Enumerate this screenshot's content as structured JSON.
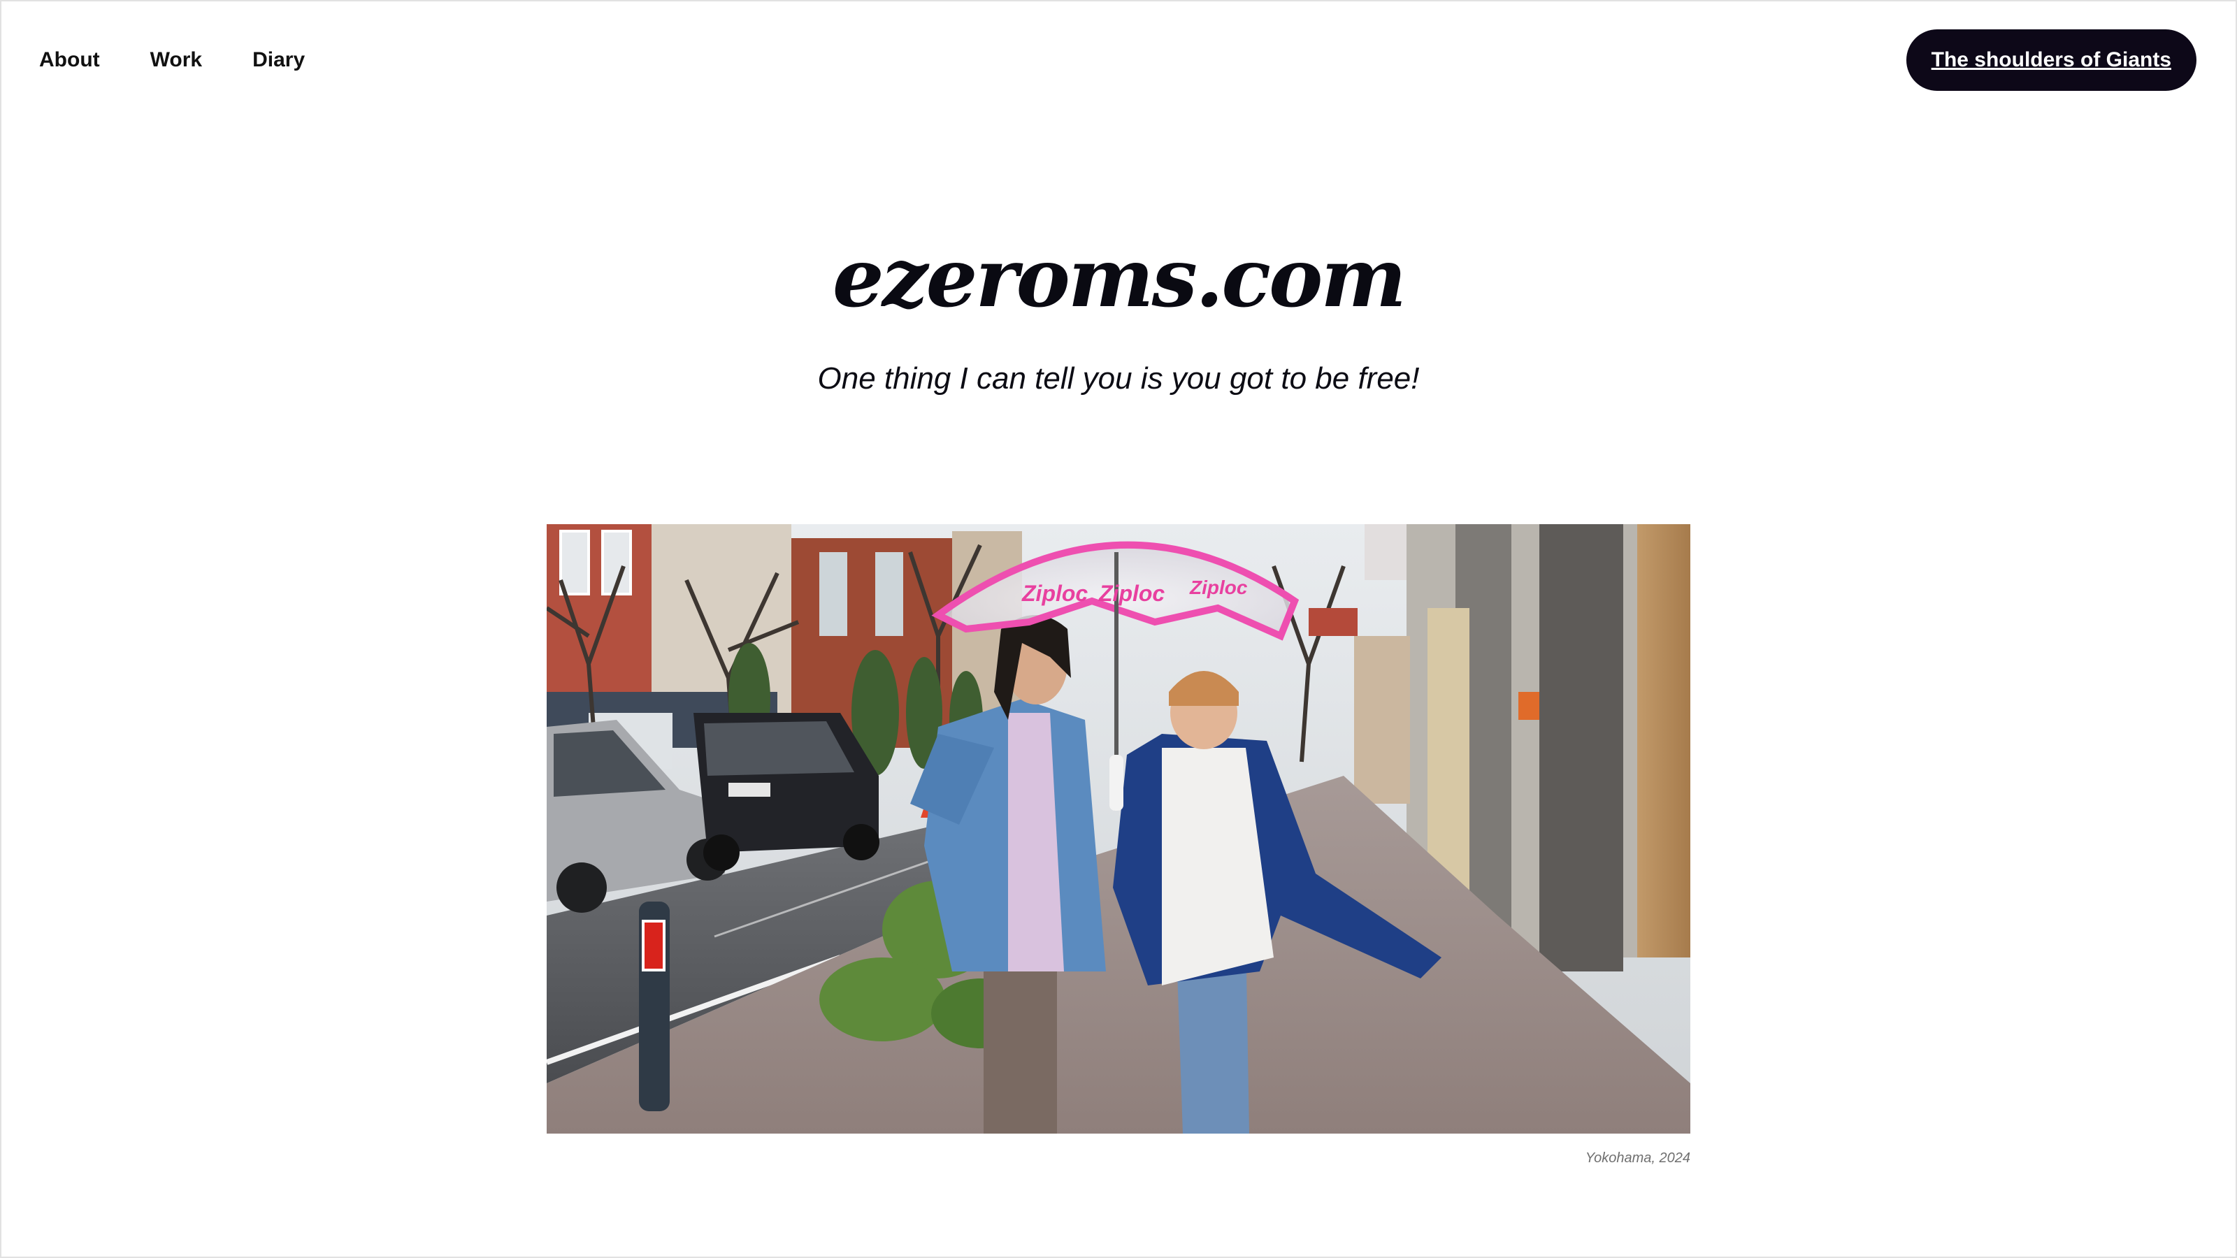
{
  "nav": {
    "items": [
      {
        "label": "About"
      },
      {
        "label": "Work"
      },
      {
        "label": "Diary"
      }
    ],
    "cta_label": "The shoulders of Giants"
  },
  "hero": {
    "title": "ezeroms.com",
    "tagline": "One thing I can tell you is you got to be free!"
  },
  "photo": {
    "caption": "Yokohama, 2024",
    "umbrella_text": "Ziploc"
  },
  "colors": {
    "cta_background": "#0d0818",
    "cta_text": "#ffffff",
    "text": "#0b0b14",
    "caption": "#6f6f6f"
  }
}
